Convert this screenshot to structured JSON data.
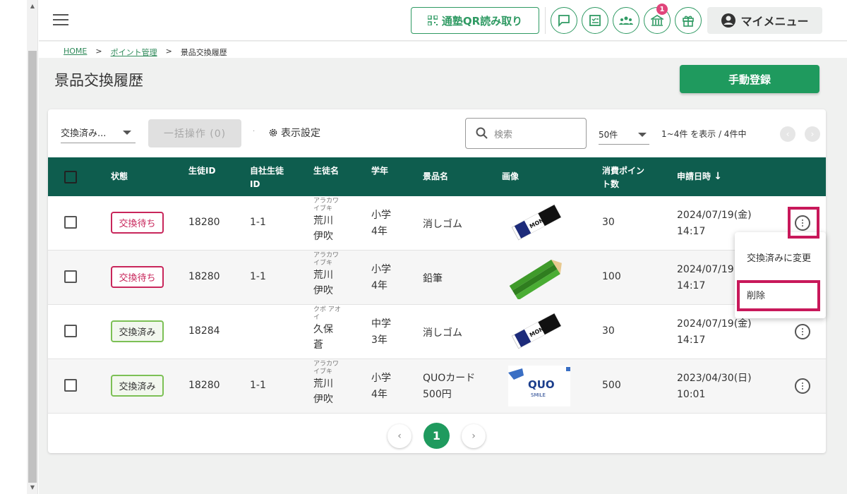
{
  "header": {
    "qr_label": "通塾QR読み取り",
    "notification_badge": "1",
    "my_menu_label": "マイメニュー"
  },
  "breadcrumb": {
    "home": "HOME",
    "sep": ">",
    "points": "ポイント管理",
    "current": "景品交換履歴"
  },
  "page": {
    "title": "景品交換履歴",
    "manual_register": "手動登録"
  },
  "toolbar": {
    "status_filter": "交換済み...",
    "bulk_action": "一括操作 (0)",
    "separator": "·",
    "view_settings": "表示設定",
    "search_placeholder": "検索",
    "per_page": "50件",
    "range_text": "1~4件 を表示 / 4件中"
  },
  "table": {
    "headers": {
      "status": "状態",
      "student_id": "生徒ID",
      "own_id_1": "自社生徒",
      "own_id_2": "ID",
      "name": "生徒名",
      "grade": "学年",
      "prize": "景品名",
      "image": "画像",
      "points_1": "消費ポイン",
      "points_2": "ト数",
      "date": "申請日時",
      "sort_arrow": "↓"
    },
    "rows": [
      {
        "status": "交換待ち",
        "student_id": "18280",
        "own_id": "1-1",
        "kana_1": "アラカワ",
        "kana_2": "イブキ",
        "name_1": "荒川",
        "name_2": "伊吹",
        "grade_1": "小学",
        "grade_2": "4年",
        "prize_1": "消しゴム",
        "prize_2": "",
        "points": "30",
        "date_1": "2024/07/19(金)",
        "date_2": "14:17"
      },
      {
        "status": "交換待ち",
        "student_id": "18280",
        "own_id": "1-1",
        "kana_1": "アラカワ",
        "kana_2": "イブキ",
        "name_1": "荒川",
        "name_2": "伊吹",
        "grade_1": "小学",
        "grade_2": "4年",
        "prize_1": "鉛筆",
        "prize_2": "",
        "points": "100",
        "date_1": "2024/07/19",
        "date_2": "14:17"
      },
      {
        "status": "交換済み",
        "student_id": "18284",
        "own_id": "",
        "kana_1": "クボ アオ",
        "kana_2": "イ",
        "name_1": "久保",
        "name_2": "蒼",
        "grade_1": "中学",
        "grade_2": "3年",
        "prize_1": "消しゴム",
        "prize_2": "",
        "points": "30",
        "date_1": "2024/07/19(金)",
        "date_2": "14:17"
      },
      {
        "status": "交換済み",
        "student_id": "18280",
        "own_id": "1-1",
        "kana_1": "アラカワ",
        "kana_2": "イブキ",
        "name_1": "荒川",
        "name_2": "伊吹",
        "grade_1": "小学",
        "grade_2": "4年",
        "prize_1": "QUOカード",
        "prize_2": "500円",
        "points": "500",
        "date_1": "2023/04/30(日)",
        "date_2": "10:01"
      }
    ],
    "eraser_text": "MONO",
    "quo_text": "QUO",
    "quo_sub": "SMILE"
  },
  "pagination": {
    "prev": "‹",
    "current": "1",
    "next": "›"
  },
  "context_menu": {
    "mark_exchanged": "交換済みに変更",
    "delete": "削除"
  },
  "colors": {
    "brand_green": "#1f9a5e",
    "table_header": "#0e5d4e",
    "wait_red": "#c8265b",
    "done_green": "#7cc055",
    "highlight": "#c8185a"
  }
}
